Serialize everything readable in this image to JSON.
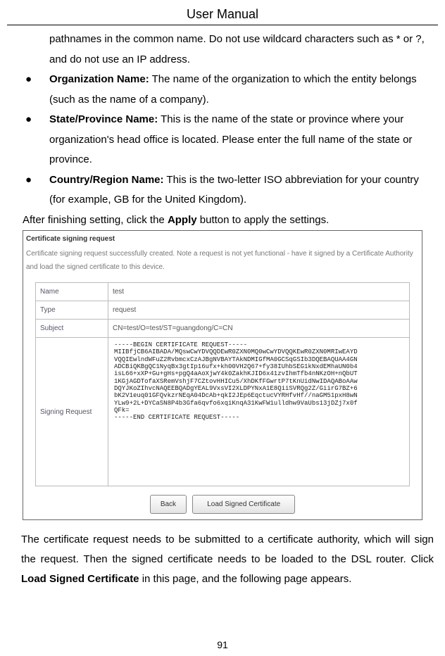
{
  "header": {
    "title": "User Manual"
  },
  "intro": {
    "cont_text": "pathnames in the common name. Do not use wildcard characters such as * or ?, and do not use an IP address."
  },
  "bullets": [
    {
      "label": "Organization Name:",
      "text": " The name of the organization to which the entity belongs (such as the name of a company)."
    },
    {
      "label": "State/Province Name:",
      "text": " This is the name of the state or province where your organization's head office is located. Please enter the full name of the state or province."
    },
    {
      "label": "Country/Region Name:",
      "text": " This is the two-letter ISO abbreviation for your country (for example, GB for the United Kingdom)."
    }
  ],
  "after": {
    "pre": "After finishing setting, click the ",
    "bold": "Apply",
    "post": " button to apply the settings."
  },
  "csr": {
    "title": "Certificate signing request",
    "note": "Certificate signing request successfully created. Note a request is not yet functional - have it signed by a Certificate Authority and load the signed certificate to this device.",
    "rows": {
      "name_label": "Name",
      "name_value": "test",
      "type_label": "Type",
      "type_value": "request",
      "subject_label": "Subject",
      "subject_value": "CN=test/O=test/ST=guangdong/C=CN",
      "sr_label": "Signing Request",
      "sr_value": "-----BEGIN CERTIFICATE REQUEST-----\nMIIBfjCB6AIBADA/MQswCwYDVQQDEwR0ZXN0MQ0wCwYDVQQKEwR0ZXN0MRIwEAYD\nVQQIEwlndWFuZ2RvbmcxCzAJBgNVBAYTAkNDMIGfMA0GCSqGSIb3DQEBAQUAA4GN\nADCBiQKBgQC1NyqBx3gtIp16ufx+kh00VH2Q67+fy38IUhbSEG1kNxdEMhaUN0b4\nisL66+xXP+Gu+gHs+pgQ4aAoXjwY4k0ZakhKJID6x41zvIhmTfb4nNKzOH+nQbUT\n1KGjAGDTofaXSRemVshjF7CZtovHHICu5/XhDKfFGwrtP7tKnUidNwIDAQABoAAw\nDQYJKoZIhvcNAQEEBQADgYEAL9VxsVI2XLDPYNxA1E8QiiSVRQg2Z/GiirG7BZ+6\nbK2V1euq01GFQvkzrNEqA04DcAb+qkI2JEp6EqctucVYRHfvHf//naGM51pxH8wN\nYLw9+2L+DYCaSN8P4b3Gfa6qvfo6xqiKnqA31KwFW1ulldhw9VaUbs13jDZj7x0f\nQFk=\n-----END CERTIFICATE REQUEST-----"
    },
    "buttons": {
      "back": "Back",
      "load": "Load Signed Certificate"
    }
  },
  "paragraph": {
    "p1": "The certificate request needs to be submitted to a certificate authority, which will sign the request. Then the signed certificate needs to be loaded to the DSL router. Click ",
    "bold": "Load Signed Certificate",
    "p2": " in this page, and the following page appears."
  },
  "page_number": "91"
}
